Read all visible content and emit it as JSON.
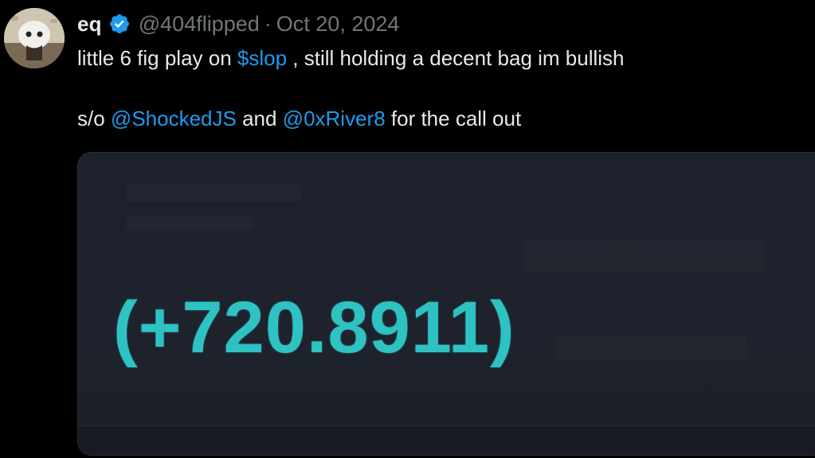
{
  "tweet": {
    "author": {
      "name": "eq",
      "handle": "@404flipped",
      "verified": true,
      "verified_icon": "verified-badge-icon"
    },
    "separator": "·",
    "date": "Oct 20, 2024",
    "line1": {
      "prefix": "little 6 fig play on ",
      "cashtag": "$slop",
      "suffix": " , still holding a decent bag im bullish"
    },
    "line2": {
      "prefix": "s/o ",
      "mention1": "@ShockedJS",
      "middle": " and ",
      "mention2": "@0xRiver8",
      "suffix": " for the call out"
    },
    "media": {
      "pnl_value": "(+720.8911)"
    }
  },
  "colors": {
    "background": "#000000",
    "text": "#e7e9ea",
    "muted": "#71767b",
    "link": "#1d9bf0",
    "verified": "#1d9bf0",
    "pnl": "#2fc2c3",
    "media_bg": "#1e222c"
  }
}
